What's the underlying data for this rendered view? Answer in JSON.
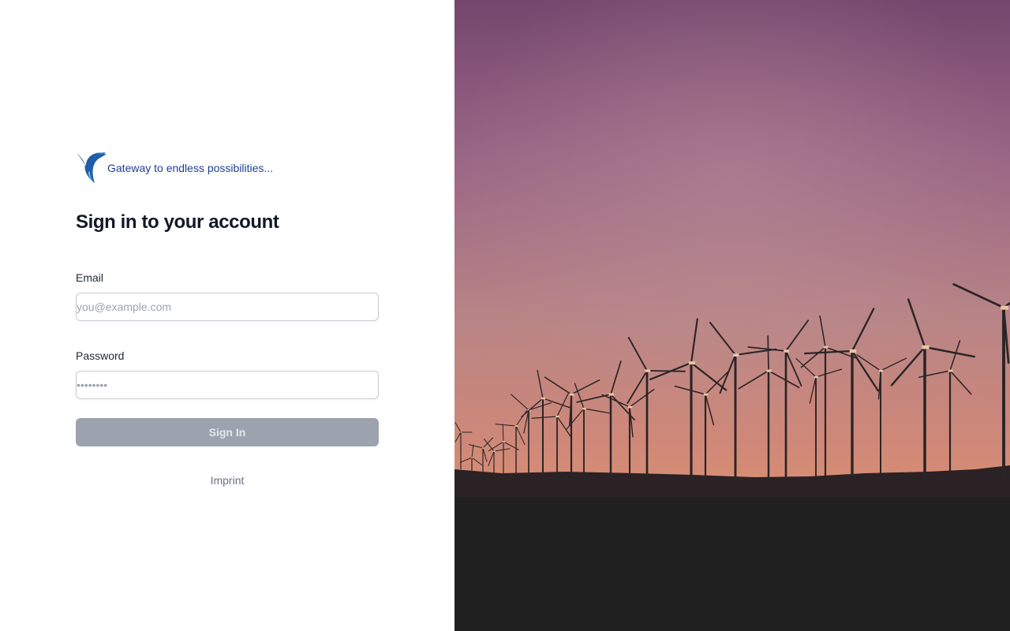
{
  "brand": {
    "tagline": "Gateway to endless possibilities...",
    "logo_icon": "hummingbird-logo",
    "color": "#1f3f91"
  },
  "form": {
    "heading": "Sign in to your account",
    "email_label": "Email",
    "email_placeholder": "you@example.com",
    "email_value": "",
    "password_label": "Password",
    "password_placeholder": "••••••••",
    "password_value": "",
    "submit_label": "Sign In",
    "submit_color": "#9ca3af"
  },
  "footer": {
    "imprint_label": "Imprint"
  },
  "hero": {
    "subject": "wind turbines at sunset",
    "sky_top": "#7b4a73",
    "sky_bottom": "#d68a74",
    "ground": "#202020"
  }
}
